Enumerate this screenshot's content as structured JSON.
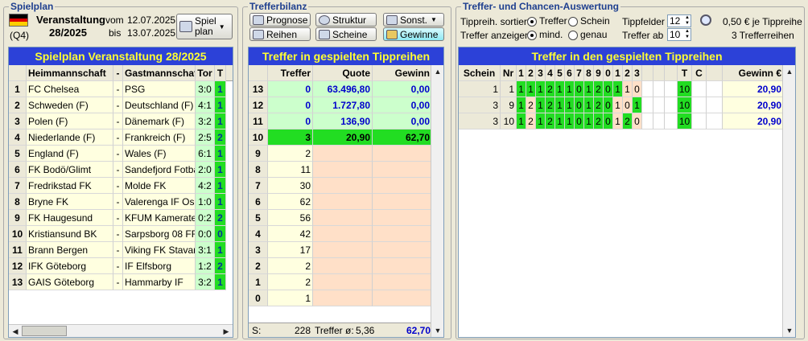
{
  "spielplan": {
    "group_title": "Spielplan",
    "event_label": "Veranstaltung",
    "event_number": "28/2025",
    "quarter": "(Q4)",
    "from_label": "vom",
    "from_date": "12.07.2025",
    "to_label": "bis",
    "to_date": "13.07.2025",
    "btn_line1": "Spiel",
    "btn_line2": "plan",
    "panel_title": "Spielplan Veranstaltung 28/2025",
    "headers": {
      "home": "Heimmannschaft",
      "sep": "-",
      "away": "Gastmannschaft",
      "score": "Tor",
      "tip": "T"
    },
    "matches": [
      {
        "n": "1",
        "home": "FC Chelsea",
        "sep": "-",
        "away": "PSG",
        "score": "3:0",
        "tip": "1"
      },
      {
        "n": "2",
        "home": "Schweden (F)",
        "sep": "-",
        "away": "Deutschland (F)",
        "score": "4:1",
        "tip": "1"
      },
      {
        "n": "3",
        "home": "Polen (F)",
        "sep": "-",
        "away": "Dänemark (F)",
        "score": "3:2",
        "tip": "1"
      },
      {
        "n": "4",
        "home": "Niederlande (F)",
        "sep": "-",
        "away": "Frankreich (F)",
        "score": "2:5",
        "tip": "2"
      },
      {
        "n": "5",
        "home": "England (F)",
        "sep": "-",
        "away": "Wales (F)",
        "score": "6:1",
        "tip": "1"
      },
      {
        "n": "6",
        "home": "FK Bodö/Glimt",
        "sep": "-",
        "away": "Sandefjord Fotball",
        "score": "2:0",
        "tip": "1"
      },
      {
        "n": "7",
        "home": "Fredrikstad FK",
        "sep": "-",
        "away": "Molde FK",
        "score": "4:2",
        "tip": "1"
      },
      {
        "n": "8",
        "home": "Bryne FK",
        "sep": "-",
        "away": "Valerenga IF Oslo",
        "score": "1:0",
        "tip": "1"
      },
      {
        "n": "9",
        "home": "FK Haugesund",
        "sep": "-",
        "away": "KFUM Kameratene",
        "score": "0:2",
        "tip": "2"
      },
      {
        "n": "10",
        "home": "Kristiansund BK",
        "sep": "-",
        "away": "Sarpsborg 08 FF",
        "score": "0:0",
        "tip": "0"
      },
      {
        "n": "11",
        "home": "Brann Bergen",
        "sep": "-",
        "away": "Viking FK Stavan...",
        "score": "3:1",
        "tip": "1"
      },
      {
        "n": "12",
        "home": "IFK Göteborg",
        "sep": "-",
        "away": "IF Elfsborg",
        "score": "1:2",
        "tip": "2"
      },
      {
        "n": "13",
        "home": "GAIS Göteborg",
        "sep": "-",
        "away": "Hammarby IF",
        "score": "3:2",
        "tip": "1"
      }
    ]
  },
  "trefferbilanz": {
    "group_title": "Trefferbilanz",
    "buttons": {
      "prognose": "Prognose",
      "struktur": "Struktur",
      "sonst": "Sonst.",
      "reihen": "Reihen",
      "scheine": "Scheine",
      "gewinne": "Gewinne"
    },
    "panel_title": "Treffer in gespielten Tippreihen",
    "headers": {
      "treffer": "Treffer",
      "quote": "Quote",
      "gewinn": "Gewinn"
    },
    "rows": [
      {
        "n": "13",
        "treffer": "0",
        "quote": "63.496,80",
        "gewinn": "0,00"
      },
      {
        "n": "12",
        "treffer": "0",
        "quote": "1.727,80",
        "gewinn": "0,00"
      },
      {
        "n": "11",
        "treffer": "0",
        "quote": "136,90",
        "gewinn": "0,00"
      },
      {
        "n": "10",
        "treffer": "3",
        "quote": "20,90",
        "gewinn": "62,70"
      },
      {
        "n": "9",
        "treffer": "2",
        "quote": "",
        "gewinn": ""
      },
      {
        "n": "8",
        "treffer": "11",
        "quote": "",
        "gewinn": ""
      },
      {
        "n": "7",
        "treffer": "30",
        "quote": "",
        "gewinn": ""
      },
      {
        "n": "6",
        "treffer": "62",
        "quote": "",
        "gewinn": ""
      },
      {
        "n": "5",
        "treffer": "56",
        "quote": "",
        "gewinn": ""
      },
      {
        "n": "4",
        "treffer": "42",
        "quote": "",
        "gewinn": ""
      },
      {
        "n": "3",
        "treffer": "17",
        "quote": "",
        "gewinn": ""
      },
      {
        "n": "2",
        "treffer": "2",
        "quote": "",
        "gewinn": ""
      },
      {
        "n": "1",
        "treffer": "2",
        "quote": "",
        "gewinn": ""
      },
      {
        "n": "0",
        "treffer": "1",
        "quote": "",
        "gewinn": ""
      }
    ],
    "footer": {
      "label": "S:",
      "total": "228",
      "avg_label": "Treffer ø:",
      "avg": "5,36",
      "gewinn": "62,70"
    }
  },
  "auswertung": {
    "group_title": "Treffer- und Chancen-Auswertung",
    "sort_label": "Tippreih. sortiert:",
    "sort_opt1": "Treffer",
    "sort_opt2": "Schein",
    "show_label": "Treffer anzeigen:",
    "show_opt1": "mind.",
    "show_opt2": "genau",
    "tippfelder_label": "Tippfelder",
    "tippfelder_value": "12",
    "treffer_ab_label": "Treffer ab",
    "treffer_ab_value": "10",
    "price_text": "0,50 € je Tippreihe",
    "rows_text": "3 Trefferreihen",
    "panel_title": "Treffer in den gespielten Tippreihen",
    "headers": {
      "schein": "Schein",
      "nr": "Nr",
      "cols": [
        "1",
        "2",
        "3",
        "4",
        "5",
        "6",
        "7",
        "8",
        "9",
        "0",
        "1",
        "2",
        "3"
      ],
      "t": "T",
      "c": "C",
      "gewinn": "Gewinn €"
    },
    "rows": [
      {
        "schein": "1",
        "nr": "1",
        "tips": [
          "1",
          "1",
          "1",
          "2",
          "1",
          "1",
          "0",
          "1",
          "2",
          "0",
          "1",
          "1",
          "0"
        ],
        "hits": [
          1,
          1,
          1,
          1,
          1,
          1,
          1,
          1,
          1,
          1,
          1,
          0,
          0
        ],
        "t": "10",
        "c": "",
        "gewinn": "20,90"
      },
      {
        "schein": "3",
        "nr": "9",
        "tips": [
          "1",
          "2",
          "1",
          "2",
          "1",
          "1",
          "0",
          "1",
          "2",
          "0",
          "1",
          "0",
          "1"
        ],
        "hits": [
          1,
          0,
          1,
          1,
          1,
          1,
          1,
          1,
          1,
          1,
          0,
          0,
          1
        ],
        "t": "10",
        "c": "",
        "gewinn": "20,90"
      },
      {
        "schein": "3",
        "nr": "10",
        "tips": [
          "1",
          "2",
          "1",
          "2",
          "1",
          "1",
          "0",
          "1",
          "2",
          "0",
          "1",
          "2",
          "0"
        ],
        "hits": [
          1,
          0,
          1,
          1,
          1,
          1,
          1,
          1,
          1,
          1,
          0,
          1,
          0
        ],
        "t": "10",
        "c": "",
        "gewinn": "20,90"
      }
    ]
  },
  "colors": {
    "title_bg": "#2c41d8",
    "title_fg": "#ffff33",
    "hit": "#22dd22",
    "miss": "#ffe0c8",
    "cream": "#ffffe0",
    "light_green": "#ccffcc"
  }
}
